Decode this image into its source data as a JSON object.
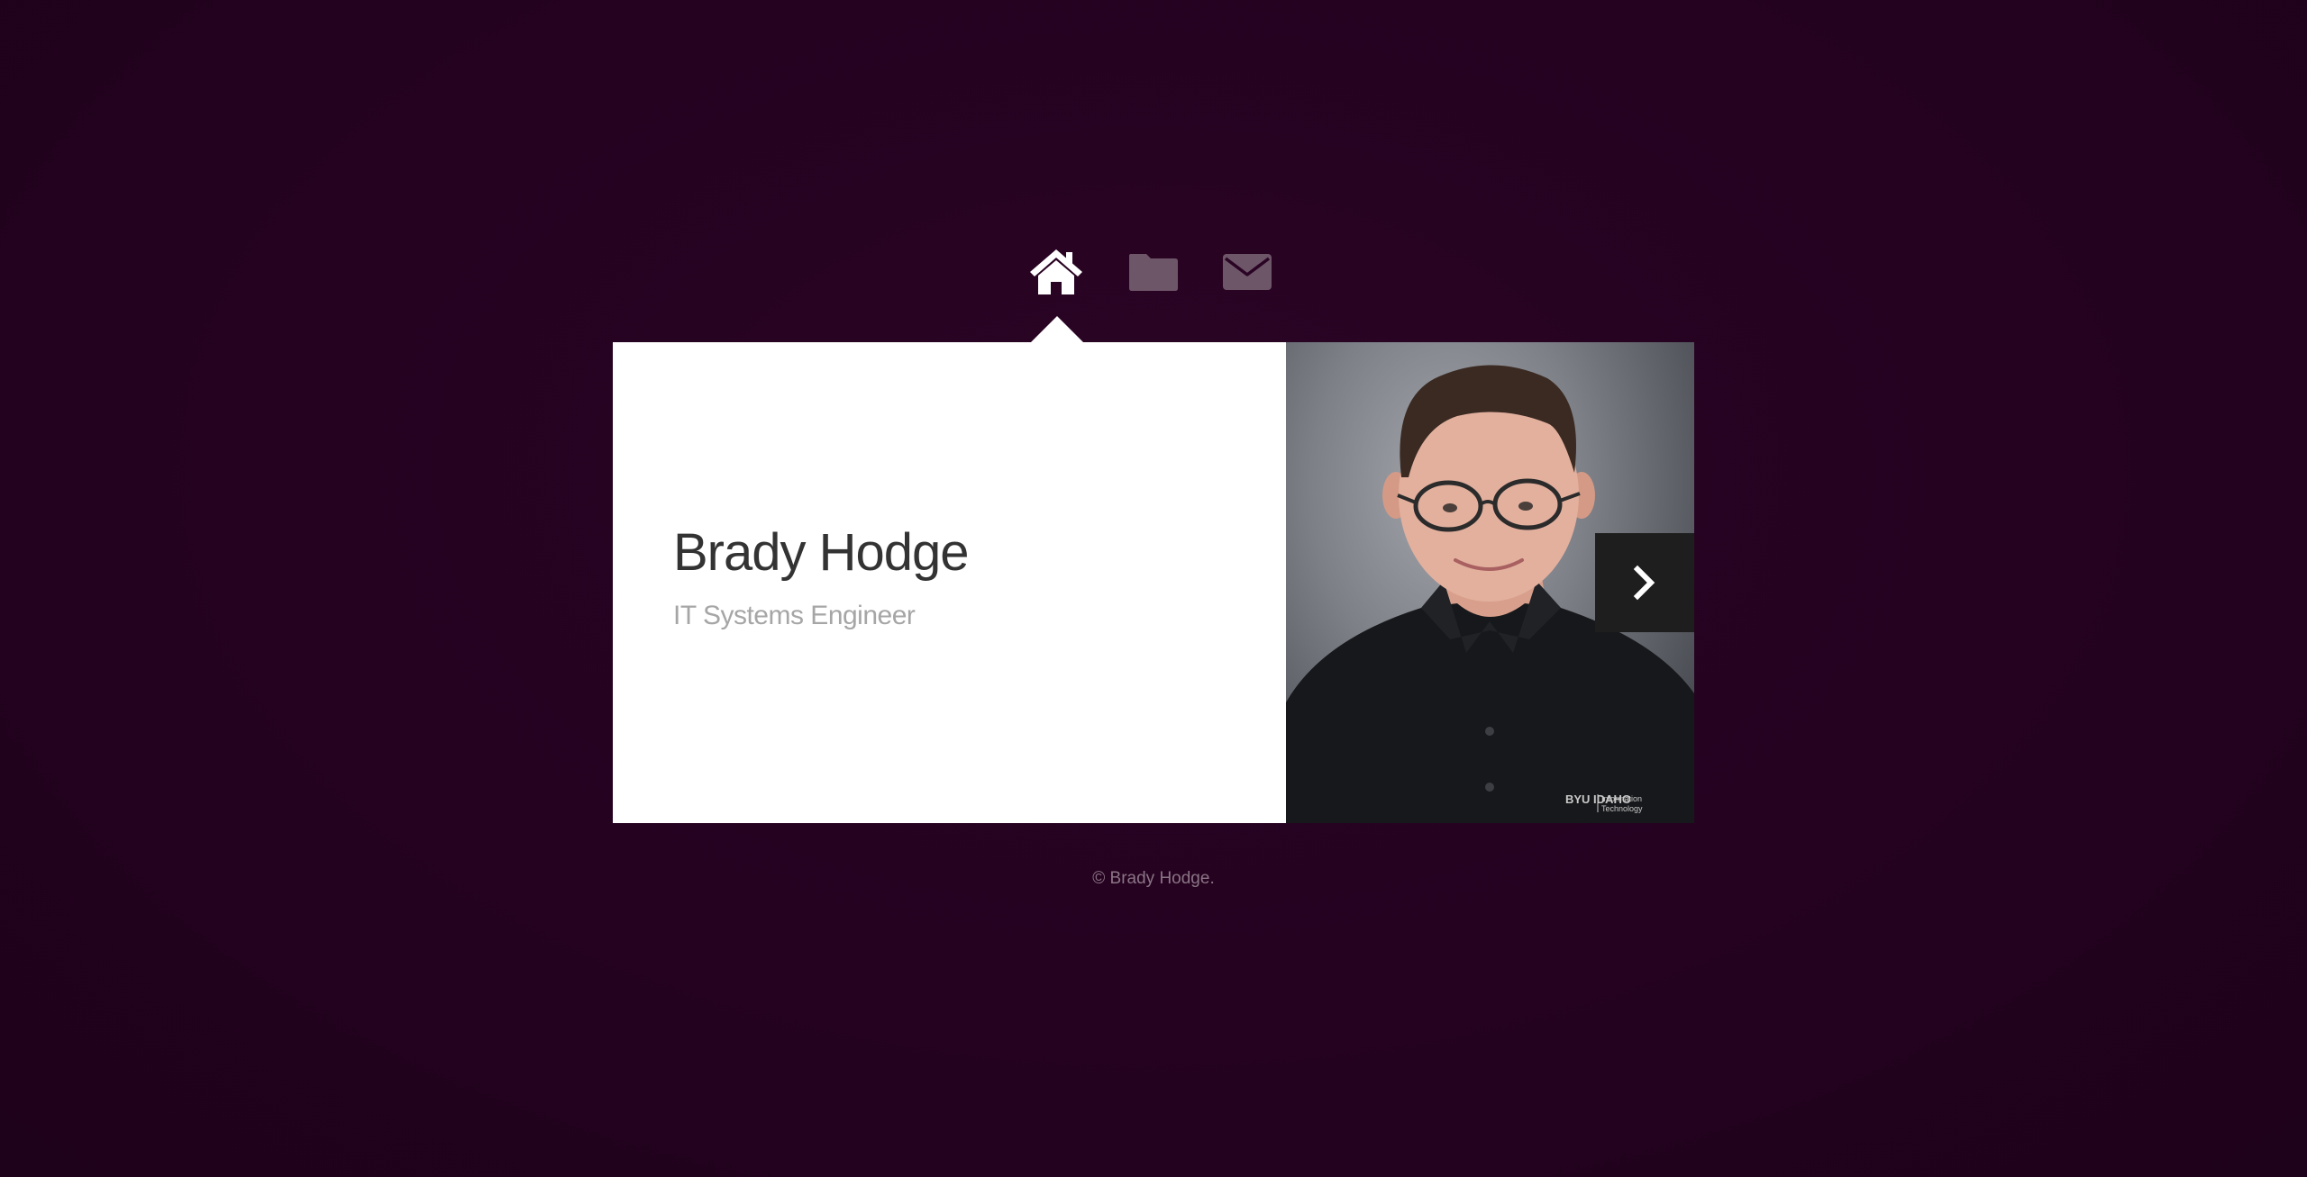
{
  "nav": {
    "items": [
      {
        "icon": "home-icon",
        "active": true
      },
      {
        "icon": "folder-icon",
        "active": false
      },
      {
        "icon": "envelope-icon",
        "active": false
      }
    ],
    "active_color": "#ffffff",
    "inactive_color": "#6e5669"
  },
  "profile": {
    "name": "Brady Hodge",
    "title": "IT Systems Engineer",
    "photo_badge": {
      "brand": "BYU IDAHO",
      "line1": "Information",
      "line2": "Technology"
    }
  },
  "controls": {
    "next_icon": "chevron-right-icon"
  },
  "footer": {
    "copyright": "© Brady Hodge."
  },
  "colors": {
    "background": "#240220",
    "card": "#ffffff",
    "name": "#333333",
    "subtitle": "#a6a6a6",
    "arrow_bg": "#1e1e1e"
  }
}
